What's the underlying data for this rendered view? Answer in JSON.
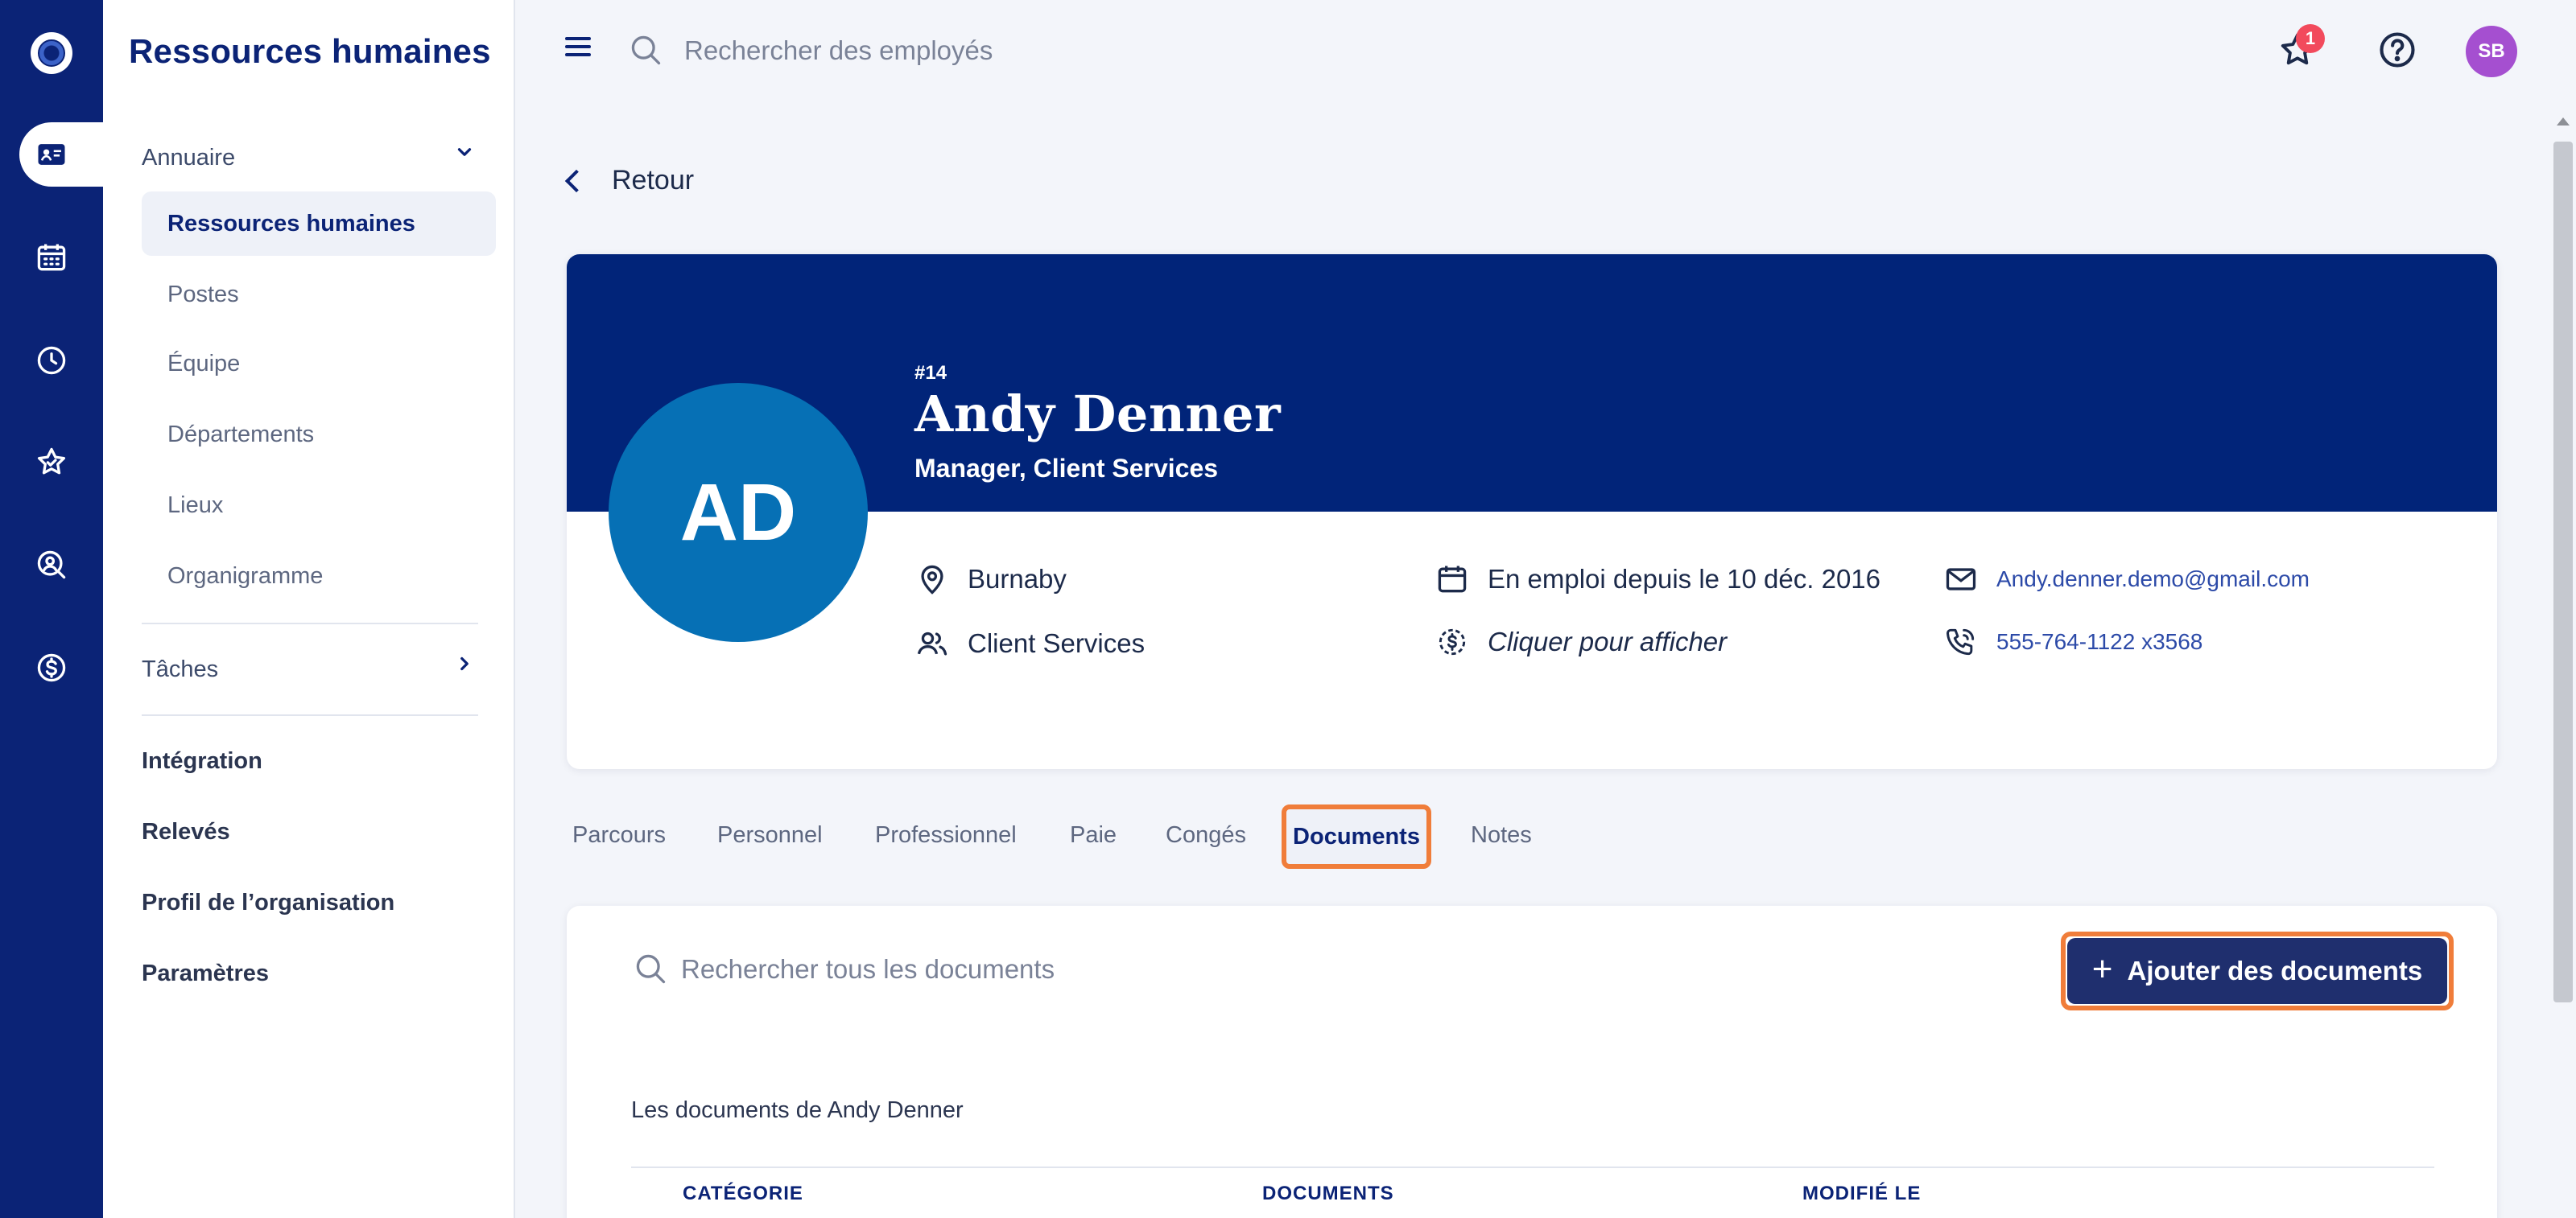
{
  "sidebar": {
    "title": "Ressources humaines",
    "groups": {
      "annuaire": "Annuaire",
      "annuaire_items": [
        "Ressources humaines",
        "Postes",
        "Équipe",
        "Départements",
        "Lieux",
        "Organigramme"
      ],
      "taches": "Tâches",
      "links": [
        "Intégration",
        "Relevés",
        "Profil de l’organisation",
        "Paramètres"
      ]
    }
  },
  "topbar": {
    "search_placeholder": "Rechercher des employés",
    "notification_count": "1",
    "user_initials": "SB"
  },
  "back_label": "Retour",
  "profile": {
    "employee_number": "#14",
    "name": "Andy Denner",
    "role": "Manager, Client Services",
    "initials": "AD",
    "location": "Burnaby",
    "department": "Client Services",
    "employment": "En emploi depuis le 10 déc. 2016",
    "salary": "Cliquer pour afficher",
    "email": "Andy.denner.demo@gmail.com",
    "phone": "555-764-1122 x3568"
  },
  "tabs": [
    "Parcours",
    "Personnel",
    "Professionnel",
    "Paie",
    "Congés",
    "Documents",
    "Notes"
  ],
  "active_tab": "Documents",
  "documents": {
    "search_placeholder": "Rechercher tous les documents",
    "add_button": "Ajouter des documents",
    "section_title": "Les documents de Andy Denner",
    "columns": [
      "CATÉGORIE",
      "DOCUMENTS",
      "MODIFIÉ LE"
    ]
  },
  "colors": {
    "rail": "#0b2376",
    "banner": "#012479",
    "avatar": "#0670b5",
    "highlight": "#f07d3a",
    "button": "#1f2f6e",
    "user_avatar": "#a54fd0",
    "badge": "#f24a5c"
  }
}
